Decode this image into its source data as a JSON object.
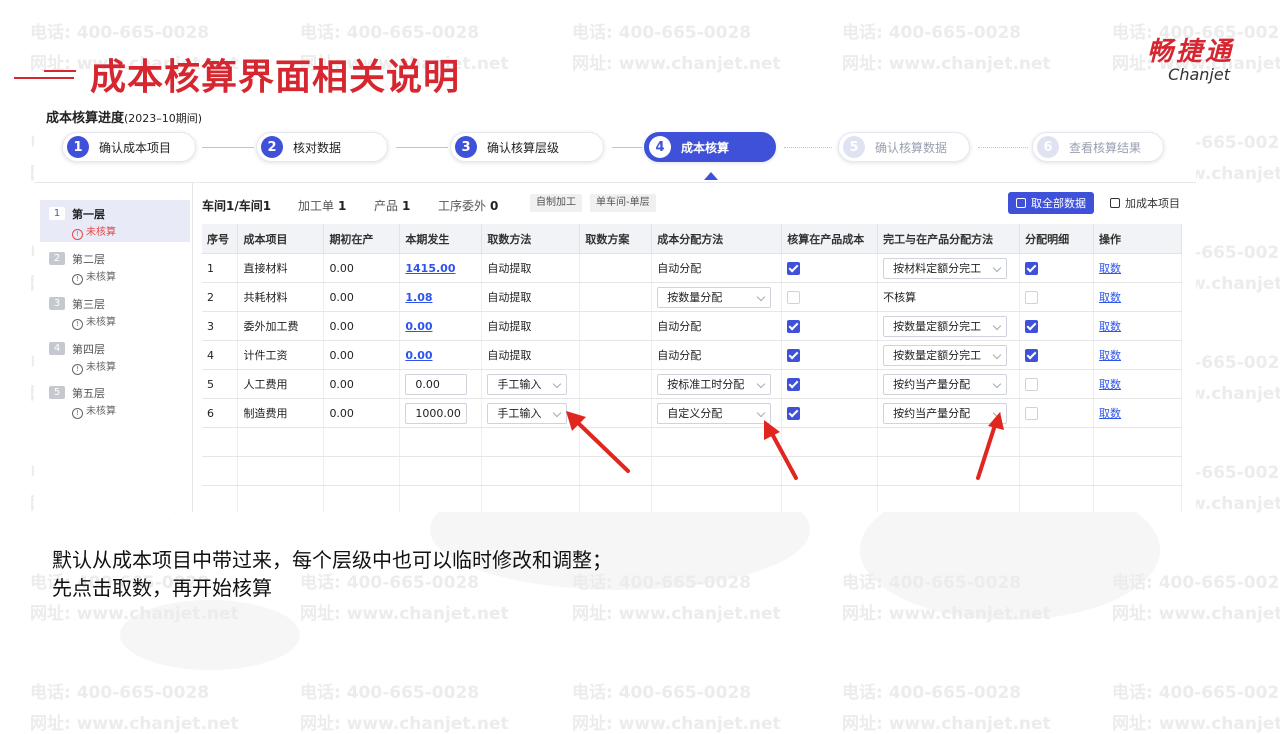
{
  "slide": {
    "title": "成本核算界面相关说明",
    "logo_cn": "畅捷通",
    "logo_en": "Chanjet",
    "watermark_phone": "电话: 400-665-0028",
    "watermark_url": "网址: www.chanjet.net",
    "note_lines": [
      "默认从成本项目中带过来，每个层级中也可以临时修改和调整；",
      "先点击取数，再开始核算"
    ]
  },
  "app": {
    "header_title": "成本核算进度",
    "header_period": "(2023–10期间)",
    "steps": [
      {
        "num": "1",
        "label": "确认成本项目",
        "state": "done"
      },
      {
        "num": "2",
        "label": "核对数据",
        "state": "done"
      },
      {
        "num": "3",
        "label": "确认核算层级",
        "state": "done"
      },
      {
        "num": "4",
        "label": "成本核算",
        "state": "active"
      },
      {
        "num": "5",
        "label": "确认核算数据",
        "state": "future"
      },
      {
        "num": "6",
        "label": "查看核算结果",
        "state": "future"
      }
    ],
    "layers": [
      {
        "num": "1",
        "name": "第一层",
        "status": "未核算",
        "active": true
      },
      {
        "num": "2",
        "name": "第二层",
        "status": "未核算",
        "active": false
      },
      {
        "num": "3",
        "name": "第三层",
        "status": "未核算",
        "active": false
      },
      {
        "num": "4",
        "name": "第四层",
        "status": "未核算",
        "active": false
      },
      {
        "num": "5",
        "name": "第五层",
        "status": "未核算",
        "active": false
      }
    ],
    "crumb": {
      "path": "车间1/车间1",
      "jgd_label": "加工单",
      "jgd_value": "1",
      "cp_label": "产品",
      "cp_value": "1",
      "gxww_label": "工序委外",
      "gxww_value": "0",
      "tag1": "自制加工",
      "tag2": "单车间-单层",
      "btn_fetch_all": "取全部数据",
      "btn_add_item": "加成本项目"
    },
    "columns": [
      "序号",
      "成本项目",
      "期初在产",
      "本期发生",
      "取数方法",
      "取数方案",
      "成本分配方法",
      "核算在产品成本",
      "完工与在产品分配方法",
      "分配明细",
      "操作"
    ],
    "rows": [
      {
        "idx": "1",
        "item": "直接材料",
        "begin": "0.00",
        "current": "1415.00",
        "method": "自动提取",
        "alloc": "自动分配",
        "calc_wip": true,
        "wip_method": "按材料定额分完工",
        "detail": true,
        "op": "取数"
      },
      {
        "idx": "2",
        "item": "共耗材料",
        "begin": "0.00",
        "current": "1.08",
        "method": "自动提取",
        "alloc": "按数量分配",
        "calc_wip": false,
        "wip_method": "不核算",
        "detail": false,
        "op": "取数"
      },
      {
        "idx": "3",
        "item": "委外加工费",
        "begin": "0.00",
        "current": "0.00",
        "method": "自动提取",
        "alloc": "自动分配",
        "calc_wip": true,
        "wip_method": "按数量定额分完工",
        "detail": true,
        "op": "取数"
      },
      {
        "idx": "4",
        "item": "计件工资",
        "begin": "0.00",
        "current": "0.00",
        "method": "自动提取",
        "alloc": "自动分配",
        "calc_wip": true,
        "wip_method": "按数量定额分完工",
        "detail": true,
        "op": "取数"
      },
      {
        "idx": "5",
        "item": "人工费用",
        "begin": "0.00",
        "current": "0.00",
        "method": "手工输入",
        "alloc": "按标准工时分配",
        "calc_wip": true,
        "wip_method": "按约当产量分配",
        "detail": false,
        "op": "取数"
      },
      {
        "idx": "6",
        "item": "制造费用",
        "begin": "0.00",
        "current": "1000.00",
        "method": "手工输入",
        "alloc": "自定义分配",
        "calc_wip": true,
        "wip_method": "按约当产量分配",
        "detail": false,
        "op": "取数"
      }
    ]
  },
  "colors": {
    "brand_red": "#d6262f",
    "primary_blue": "#3f51d9",
    "link_blue": "#2f54eb"
  }
}
